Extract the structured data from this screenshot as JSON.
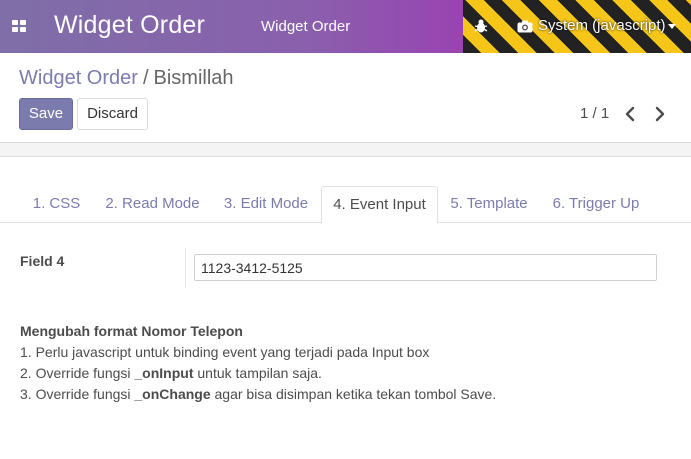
{
  "navbar": {
    "brand": "Widget Order",
    "menu_label": "Widget Order",
    "user_label": "System (javascript)",
    "icons": [
      "apps-icon",
      "bug-icon",
      "camera-icon",
      "caret-down-icon"
    ]
  },
  "breadcrumb": {
    "parent": "Widget Order",
    "separator": "/",
    "current": "Bismillah"
  },
  "buttons": {
    "save": "Save",
    "discard": "Discard"
  },
  "pager": {
    "value": "1 / 1"
  },
  "tabs": [
    {
      "label": "1. CSS"
    },
    {
      "label": "2. Read Mode"
    },
    {
      "label": "3. Edit Mode"
    },
    {
      "label": "4. Event Input"
    },
    {
      "label": "5. Template"
    },
    {
      "label": "6. Trigger Up"
    }
  ],
  "active_tab": "4. Event Input",
  "form": {
    "field_label": "Field 4",
    "field_value": "1123-3412-5125"
  },
  "notes": {
    "title": "Mengubah format Nomor Telepon",
    "line1": "1. Perlu javascript untuk binding event yang terjadi pada Input box",
    "line2_prefix": "2. Override fungsi ",
    "line2_bold": "_onInput",
    "line2_suffix": " untuk tampilan saja.",
    "line3_prefix": "3. Override fungsi ",
    "line3_bold": "_onChange",
    "line3_suffix": " agar bisa disimpan ketika tekan tombol Save."
  },
  "colors": {
    "primary": "#7c7bad",
    "navbar_start": "#7f6fa8",
    "navbar_end": "#a73fb8",
    "debug_yellow": "#f5c518"
  }
}
